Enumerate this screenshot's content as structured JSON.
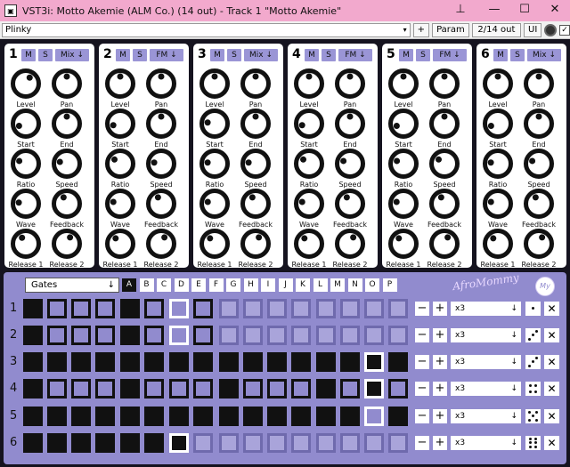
{
  "window": {
    "title": "VST3i: Motto Akemie (ALM Co.) (14 out) - Track 1 \"Motto Akemie\"",
    "pin_icon": "pin-icon",
    "minimize": "—",
    "maximize": "☐",
    "close": "✕"
  },
  "toolbar": {
    "preset": "Plinky",
    "preset_arrow": "▾",
    "plus": "+",
    "param": "Param",
    "io": "2/14 out",
    "ui": "UI",
    "bypass_check": "✓"
  },
  "knob_labels": [
    "Level",
    "Pan",
    "Start",
    "End",
    "Ratio",
    "Speed",
    "Wave",
    "Feedback",
    "Release 1",
    "Release 2"
  ],
  "channels": [
    {
      "num": "1",
      "m": "M",
      "s": "S",
      "mode": "Mix ↓",
      "knobs": [
        0.62,
        0.5,
        0.1,
        0.5,
        0.25,
        0.22,
        0.2,
        0.4,
        0.38,
        0.6
      ]
    },
    {
      "num": "2",
      "m": "M",
      "s": "S",
      "mode": "FM ↓",
      "knobs": [
        0.5,
        0.5,
        0.12,
        0.5,
        0.3,
        0.2,
        0.22,
        0.4,
        0.35,
        0.6
      ]
    },
    {
      "num": "3",
      "m": "M",
      "s": "S",
      "mode": "Mix ↓",
      "knobs": [
        0.5,
        0.5,
        0.2,
        0.5,
        0.2,
        0.2,
        0.22,
        0.4,
        0.35,
        0.6
      ]
    },
    {
      "num": "4",
      "m": "M",
      "s": "S",
      "mode": "FM ↓",
      "knobs": [
        0.5,
        0.5,
        0.12,
        0.5,
        0.3,
        0.25,
        0.22,
        0.4,
        0.35,
        0.6
      ]
    },
    {
      "num": "5",
      "m": "M",
      "s": "S",
      "mode": "FM ↓",
      "knobs": [
        0.5,
        0.5,
        0.1,
        0.5,
        0.25,
        0.3,
        0.22,
        0.4,
        0.35,
        0.6
      ]
    },
    {
      "num": "6",
      "m": "M",
      "s": "S",
      "mode": "Mix ↓",
      "knobs": [
        0.5,
        0.5,
        0.1,
        0.5,
        0.2,
        0.25,
        0.22,
        0.4,
        0.35,
        0.6
      ]
    }
  ],
  "gates": {
    "selector": "Gates",
    "selector_arrow": "↓",
    "tabs": [
      "A",
      "B",
      "C",
      "D",
      "E",
      "F",
      "G",
      "H",
      "I",
      "J",
      "K",
      "L",
      "M",
      "N",
      "O",
      "P"
    ],
    "active_tab": 0,
    "logo": "AfroMommy",
    "badge": "My",
    "rows": [
      {
        "num": "1",
        "length": 8,
        "steps": [
          1,
          0,
          0,
          0,
          1,
          0,
          0,
          0,
          0,
          0,
          0,
          0,
          0,
          0,
          0,
          0
        ],
        "current": 6,
        "minus": "−",
        "plus": "+",
        "mult": "x3",
        "arrow": "↓",
        "dice": 1,
        "close": "✕"
      },
      {
        "num": "2",
        "length": 8,
        "steps": [
          1,
          0,
          0,
          0,
          1,
          0,
          0,
          0,
          0,
          0,
          0,
          0,
          0,
          0,
          0,
          0
        ],
        "current": 6,
        "minus": "−",
        "plus": "+",
        "mult": "x3",
        "arrow": "↓",
        "dice": 3,
        "close": "✕"
      },
      {
        "num": "3",
        "length": 16,
        "steps": [
          1,
          1,
          1,
          1,
          1,
          1,
          1,
          1,
          1,
          1,
          1,
          1,
          1,
          1,
          1,
          1
        ],
        "current": 14,
        "minus": "−",
        "plus": "+",
        "mult": "x3",
        "arrow": "↓",
        "dice": 3,
        "close": "✕"
      },
      {
        "num": "4",
        "length": 16,
        "steps": [
          1,
          0,
          0,
          0,
          1,
          0,
          0,
          0,
          1,
          0,
          0,
          0,
          1,
          0,
          1,
          0
        ],
        "current": 14,
        "minus": "−",
        "plus": "+",
        "mult": "x3",
        "arrow": "↓",
        "dice": 4,
        "close": "✕"
      },
      {
        "num": "5",
        "length": 16,
        "steps": [
          1,
          1,
          1,
          1,
          1,
          1,
          1,
          1,
          1,
          1,
          1,
          1,
          1,
          1,
          0,
          1
        ],
        "current": 14,
        "minus": "−",
        "plus": "+",
        "mult": "x3",
        "arrow": "↓",
        "dice": 5,
        "close": "✕"
      },
      {
        "num": "6",
        "length": 7,
        "steps": [
          1,
          1,
          1,
          1,
          1,
          1,
          1,
          0,
          0,
          0,
          0,
          0,
          0,
          0,
          0,
          0
        ],
        "current": 6,
        "minus": "−",
        "plus": "+",
        "mult": "x3",
        "arrow": "↓",
        "dice": 6,
        "close": "✕"
      }
    ]
  }
}
